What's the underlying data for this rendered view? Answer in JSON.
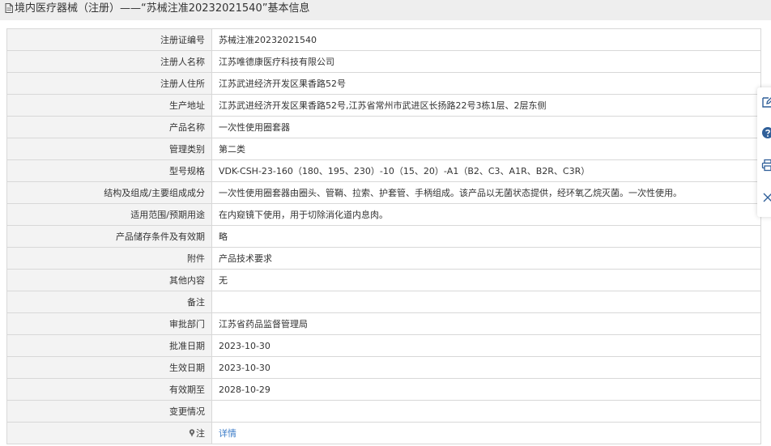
{
  "header": {
    "title": "境内医疗器械（注册）——“苏械注准20232021540”基本信息"
  },
  "rows": [
    {
      "label": "注册证编号",
      "value": "苏械注准20232021540"
    },
    {
      "label": "注册人名称",
      "value": "江苏唯德康医疗科技有限公司"
    },
    {
      "label": "注册人住所",
      "value": "江苏武进经济开发区果香路52号"
    },
    {
      "label": "生产地址",
      "value": "江苏武进经济开发区果香路52号,江苏省常州市武进区长扬路22号3栋1层、2层东侧"
    },
    {
      "label": "产品名称",
      "value": "一次性使用圈套器"
    },
    {
      "label": "管理类别",
      "value": "第二类"
    },
    {
      "label": "型号规格",
      "value": "VDK-CSH-23-160（180、195、230）-10（15、20）-A1（B2、C3、A1R、B2R、C3R）"
    },
    {
      "label": "结构及组成/主要组成成分",
      "value": "一次性使用圈套器由圈头、管鞘、拉索、护套管、手柄组成。该产品以无菌状态提供，经环氧乙烷灭菌。一次性使用。"
    },
    {
      "label": "适用范围/预期用途",
      "value": "在内窥镜下使用，用于切除消化道内息肉。"
    },
    {
      "label": "产品储存条件及有效期",
      "value": "略"
    },
    {
      "label": "附件",
      "value": "产品技术要求"
    },
    {
      "label": "其他内容",
      "value": "无"
    },
    {
      "label": "备注",
      "value": ""
    },
    {
      "label": "审批部门",
      "value": "江苏省药品监督管理局"
    },
    {
      "label": "批准日期",
      "value": "2023-10-30"
    },
    {
      "label": "生效日期",
      "value": "2023-10-30"
    },
    {
      "label": "有效期至",
      "value": "2028-10-29"
    },
    {
      "label": "变更情况",
      "value": ""
    }
  ],
  "note_row": {
    "label": "注",
    "link": "详情",
    "icon": "pin-icon"
  },
  "sidebar": {
    "tools": [
      "edit-icon",
      "help-icon",
      "print-icon",
      "close-icon"
    ]
  },
  "colors": {
    "label_bg": "#f3f3f3",
    "border": "#d8d8d8",
    "link": "#3c7cc8",
    "header_bg": "#eeeeee"
  }
}
